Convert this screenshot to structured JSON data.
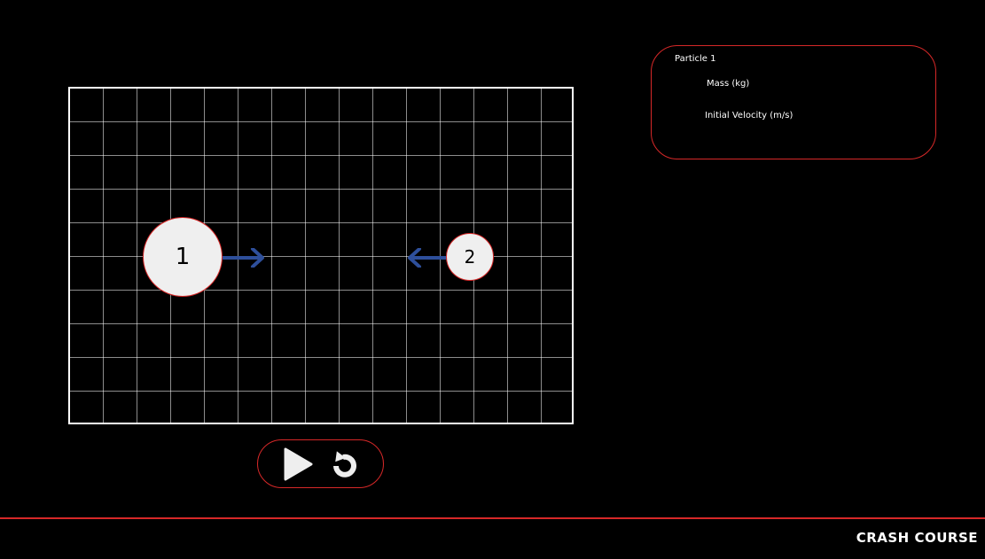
{
  "simulation": {
    "particles": [
      {
        "label": "1"
      },
      {
        "label": "2"
      }
    ],
    "arrow_color": "#2e4f9b",
    "particle_fill": "#efefef",
    "accent_color": "#d62828"
  },
  "controls": {
    "play_icon": "play-icon",
    "reset_icon": "reset-icon"
  },
  "panel": {
    "title": "Particle 1",
    "mass_label": "Mass (kg)",
    "velocity_label": "Initial Velocity (m/s)"
  },
  "footer": {
    "brand": "CRASH COURSE"
  }
}
